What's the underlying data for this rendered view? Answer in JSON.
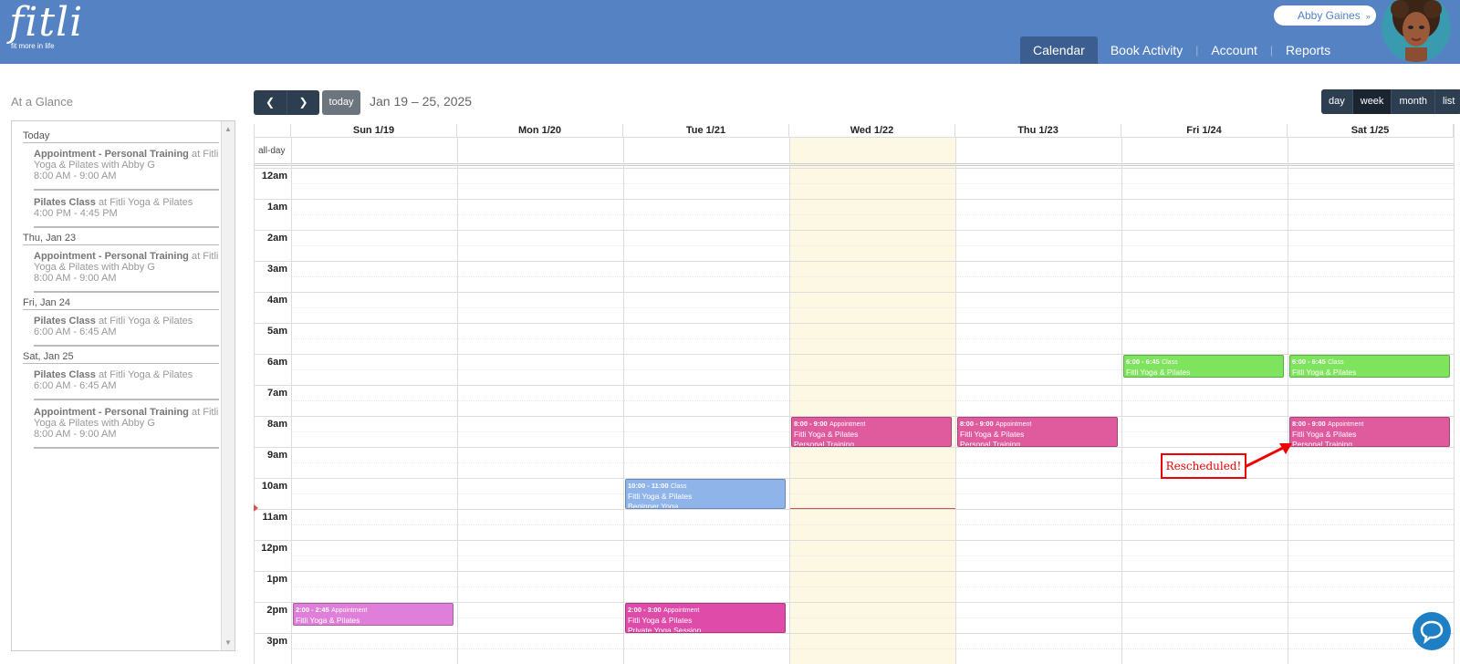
{
  "brand": {
    "logo_text": "fitli",
    "tagline": "fit more in life"
  },
  "user": {
    "name": "Abby Gaines",
    "menu_icon": "chevron-double-down"
  },
  "nav": [
    {
      "label": "Calendar",
      "active": true
    },
    {
      "label": "Book Activity",
      "active": false
    },
    {
      "label": "Account",
      "active": false
    },
    {
      "label": "Reports",
      "active": false
    }
  ],
  "glance": {
    "title": "At a Glance",
    "days": [
      {
        "label": "Today",
        "items": [
          {
            "title": "Appointment - Personal Training",
            "prefix": "at",
            "place": "Fitli Yoga & Pilates with Abby G",
            "time": "8:00 AM - 9:00 AM"
          },
          {
            "title": "Pilates Class",
            "prefix": "at",
            "place": "Fitli Yoga & Pilates",
            "time": "4:00 PM - 4:45 PM"
          }
        ]
      },
      {
        "label": "Thu, Jan 23",
        "items": [
          {
            "title": "Appointment - Personal Training",
            "prefix": "at",
            "place": "Fitli Yoga & Pilates with Abby G",
            "time": "8:00 AM - 9:00 AM"
          }
        ]
      },
      {
        "label": "Fri, Jan 24",
        "items": [
          {
            "title": "Pilates Class",
            "prefix": "at",
            "place": "Fitli Yoga & Pilates",
            "time": "6:00 AM - 6:45 AM"
          }
        ]
      },
      {
        "label": "Sat, Jan 25",
        "items": [
          {
            "title": "Pilates Class",
            "prefix": "at",
            "place": "Fitli Yoga & Pilates",
            "time": "6:00 AM - 6:45 AM"
          },
          {
            "title": "Appointment - Personal Training",
            "prefix": "at",
            "place": "Fitli Yoga & Pilates with Abby G",
            "time": "8:00 AM - 9:00 AM"
          }
        ]
      }
    ]
  },
  "toolbar": {
    "prev_icon": "chevron-left",
    "next_icon": "chevron-right",
    "today_label": "today",
    "range": "Jan 19 – 25, 2025",
    "views": [
      {
        "label": "day",
        "active": false
      },
      {
        "label": "week",
        "active": true
      },
      {
        "label": "month",
        "active": false
      },
      {
        "label": "list",
        "active": false
      }
    ]
  },
  "calendar": {
    "allday_label": "all-day",
    "days": [
      "Sun 1/19",
      "Mon 1/20",
      "Tue 1/21",
      "Wed 1/22",
      "Thu 1/23",
      "Fri 1/24",
      "Sat 1/25"
    ],
    "today_index": 3,
    "hours": [
      "12am",
      "1am",
      "2am",
      "3am",
      "4am",
      "5am",
      "6am",
      "7am",
      "8am",
      "9am",
      "10am",
      "11am",
      "12pm",
      "1pm",
      "2pm",
      "3pm"
    ],
    "now_hour": 10.98,
    "events": [
      {
        "day": 0,
        "start": 14.0,
        "end": 14.75,
        "time": "2:00 - 2:45",
        "kind": "Appointment",
        "lines": [
          "Fitli Yoga & Pilates"
        ],
        "color": "#e07fd9"
      },
      {
        "day": 2,
        "start": 10.0,
        "end": 11.0,
        "time": "10:00 - 11:00",
        "kind": "Class",
        "lines": [
          "Fitli Yoga & Pilates",
          "Beginner Yoga"
        ],
        "color": "#8fb4ea"
      },
      {
        "day": 2,
        "start": 14.0,
        "end": 15.0,
        "time": "2:00 - 3:00",
        "kind": "Appointment",
        "lines": [
          "Fitli Yoga & Pilates",
          "Private Yoga Session"
        ],
        "color": "#df4ba8"
      },
      {
        "day": 3,
        "start": 8.0,
        "end": 9.0,
        "time": "8:00 - 9:00",
        "kind": "Appointment",
        "lines": [
          "Fitli Yoga & Pilates",
          "Personal Training"
        ],
        "color": "#e05a9e"
      },
      {
        "day": 4,
        "start": 8.0,
        "end": 9.0,
        "time": "8:00 - 9:00",
        "kind": "Appointment",
        "lines": [
          "Fitli Yoga & Pilates",
          "Personal Training"
        ],
        "color": "#e05a9e"
      },
      {
        "day": 5,
        "start": 6.0,
        "end": 6.75,
        "time": "6:00 - 6:45",
        "kind": "Class",
        "lines": [
          "Fitli Yoga & Pilates"
        ],
        "color": "#7ee35d"
      },
      {
        "day": 6,
        "start": 6.0,
        "end": 6.75,
        "time": "6:00 - 6:45",
        "kind": "Class",
        "lines": [
          "Fitli Yoga & Pilates"
        ],
        "color": "#7ee35d"
      },
      {
        "day": 6,
        "start": 8.0,
        "end": 9.0,
        "time": "8:00 - 9:00",
        "kind": "Appointment",
        "lines": [
          "Fitli Yoga & Pilates",
          "Personal Training"
        ],
        "color": "#e05a9e"
      }
    ]
  },
  "annotation": {
    "text": "Rescheduled!",
    "color": "#e00000"
  },
  "chat_icon": "chat-bubble-icon"
}
